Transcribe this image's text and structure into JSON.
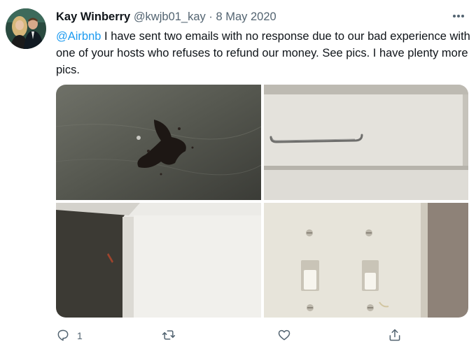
{
  "tweet": {
    "display_name": "Kay Winberry",
    "handle": "@kwjb01_kay",
    "separator": "·",
    "date": "8 May 2020",
    "mention": "@Airbnb",
    "body": " I have sent two emails with no response due to our bad experience with one of your hosts who refuses to refund our money. See pics.  I have plenty more pics."
  },
  "actions": {
    "reply_count": "1"
  },
  "colors": {
    "accent": "#1d9bf0",
    "secondary_text": "#536471"
  },
  "icons": {
    "more": "more-icon",
    "reply": "reply-icon",
    "retweet": "retweet-icon",
    "like": "heart-icon",
    "share": "share-icon"
  }
}
